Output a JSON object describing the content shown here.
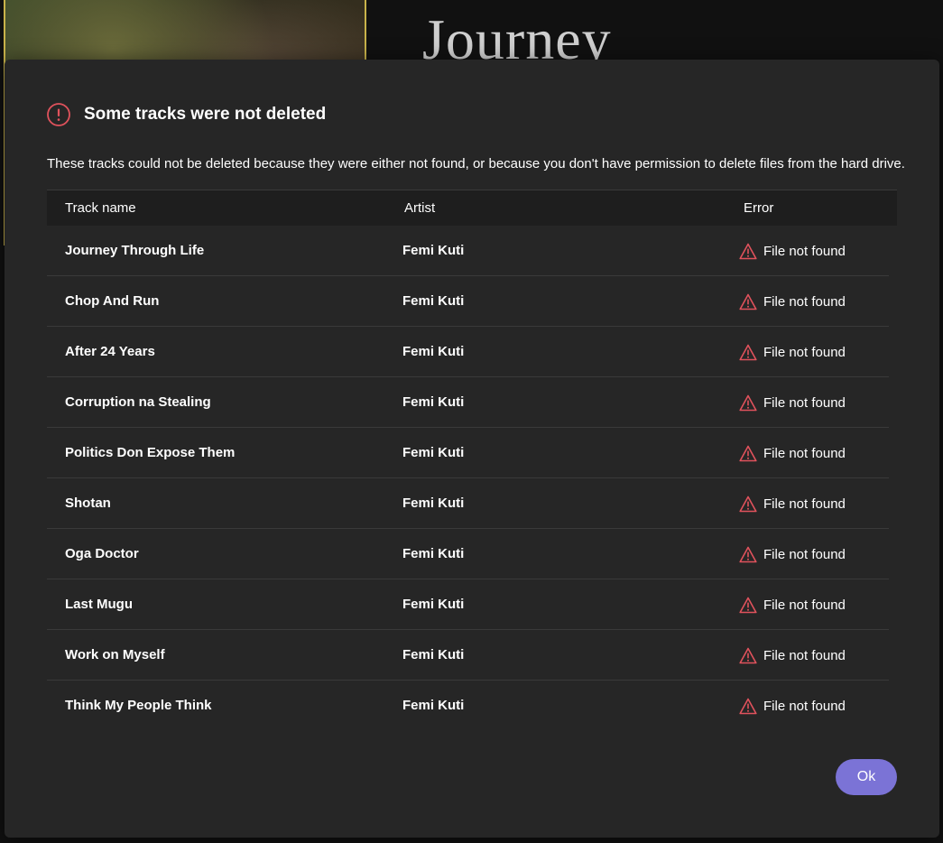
{
  "background": {
    "album_title": "Journey"
  },
  "dialog": {
    "title": "Some tracks were not deleted",
    "description": "These tracks could not be deleted because they were either not found, or because you don't have permission to delete files from the hard drive.",
    "ok_label": "Ok",
    "columns": {
      "track": "Track name",
      "artist": "Artist",
      "error": "Error"
    },
    "rows": [
      {
        "track": "Journey Through Life",
        "artist": "Femi Kuti",
        "error": "File not found"
      },
      {
        "track": "Chop And Run",
        "artist": "Femi Kuti",
        "error": "File not found"
      },
      {
        "track": "After 24 Years",
        "artist": "Femi Kuti",
        "error": "File not found"
      },
      {
        "track": "Corruption na Stealing",
        "artist": "Femi Kuti",
        "error": "File not found"
      },
      {
        "track": "Politics Don Expose Them",
        "artist": "Femi Kuti",
        "error": "File not found"
      },
      {
        "track": "Shotan",
        "artist": "Femi Kuti",
        "error": "File not found"
      },
      {
        "track": "Oga Doctor",
        "artist": "Femi Kuti",
        "error": "File not found"
      },
      {
        "track": "Last Mugu",
        "artist": "Femi Kuti",
        "error": "File not found"
      },
      {
        "track": "Work on Myself",
        "artist": "Femi Kuti",
        "error": "File not found"
      },
      {
        "track": "Think My People Think",
        "artist": "Femi Kuti",
        "error": "File not found"
      }
    ]
  },
  "icons": {
    "dialog_icon": "alert-circle-icon",
    "row_icon": "warning-triangle-icon"
  },
  "colors": {
    "accent": "#7b73d6",
    "error": "#e0525c",
    "dialog_bg": "#262626"
  }
}
